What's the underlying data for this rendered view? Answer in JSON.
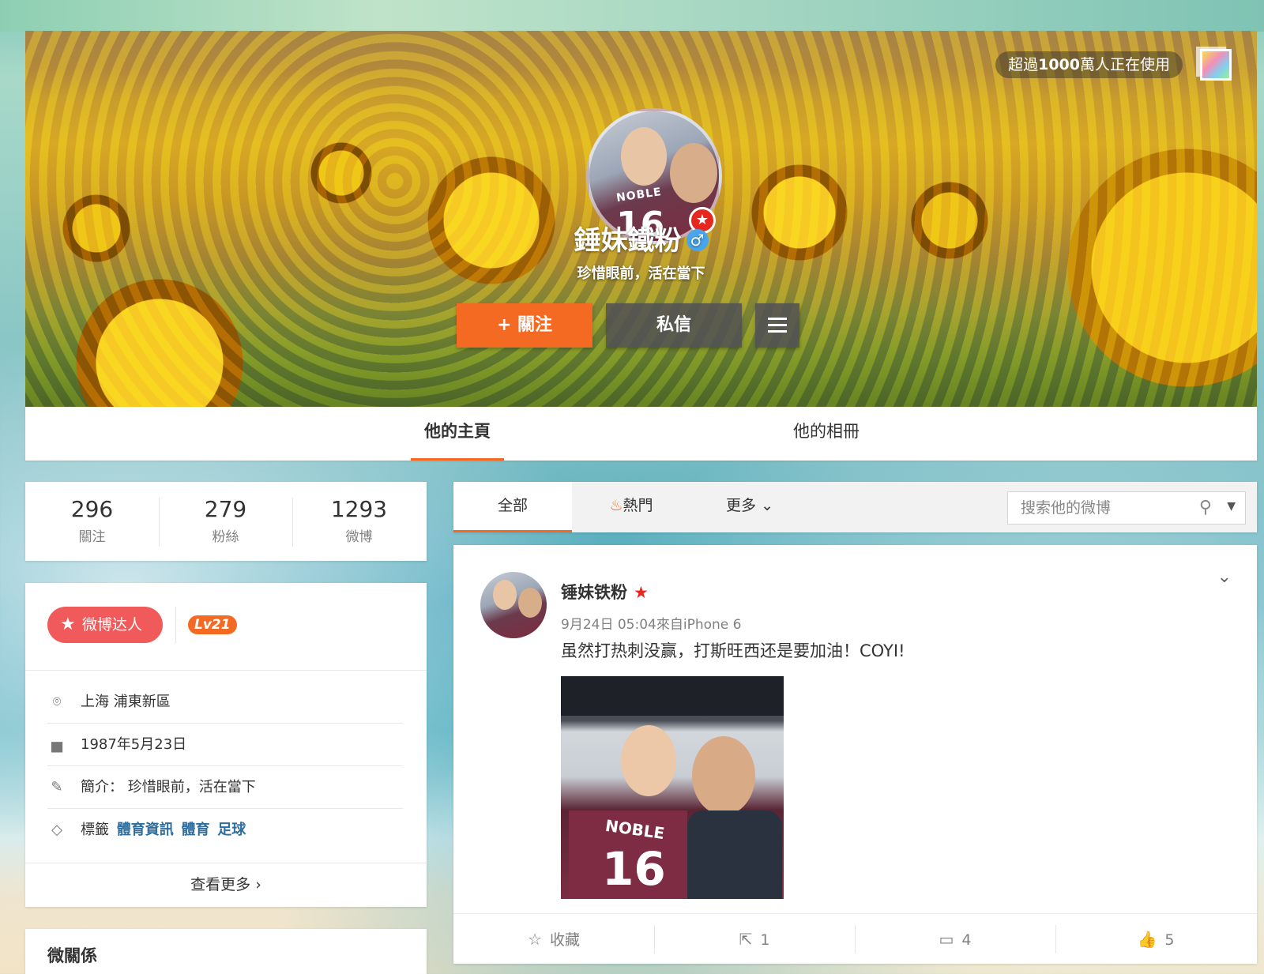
{
  "banner": {
    "usage_prefix": "超過",
    "usage_count": "1000",
    "usage_suffix": "萬人正在使用",
    "nickname": "錘妹鐵粉",
    "gender_symbol": "♂",
    "motto": "珍惜眼前，活在當下",
    "follow_label": "+ 關注",
    "message_label": "私信",
    "avatar_jersey_name": "NOBLE",
    "avatar_jersey_number": "16"
  },
  "tabs": [
    {
      "label": "他的主頁",
      "active": true
    },
    {
      "label": "他的相冊",
      "active": false
    }
  ],
  "stats": [
    {
      "value": "296",
      "label": "關注"
    },
    {
      "value": "279",
      "label": "粉絲"
    },
    {
      "value": "1293",
      "label": "微博"
    }
  ],
  "profile": {
    "talent_badge": "微博达人",
    "level": "Lv21",
    "location": "上海 浦東新區",
    "birthday": "1987年5月23日",
    "intro_label": "簡介：",
    "intro": "珍惜眼前，活在當下",
    "tags_label": "標籤",
    "tags": [
      "體育資訊",
      "體育",
      "足球"
    ],
    "see_more": "查看更多 ›"
  },
  "relation": {
    "title": "微關係"
  },
  "feed_tabs": {
    "all": "全部",
    "hot": "熱門",
    "more": "更多",
    "search_placeholder": "搜索他的微博"
  },
  "post": {
    "author": "锤妹铁粉",
    "date": "9月24日 05:04",
    "source_prefix": "來自",
    "source": "iPhone 6",
    "text": "虽然打热刺没赢，打斯旺西还是要加油！COYI!",
    "photo_jersey_name": "NOBLE",
    "photo_jersey_number": "16",
    "actions": [
      {
        "label": "收藏",
        "icon": "star-outline-icon"
      },
      {
        "label": "1",
        "icon": "share-icon"
      },
      {
        "label": "4",
        "icon": "comment-icon"
      },
      {
        "label": "5",
        "icon": "thumbs-up-icon"
      }
    ]
  },
  "colors": {
    "accent": "#f46a22",
    "talent": "#f05a5a",
    "tag_link": "#2f6e9e",
    "verified_red": "#e6261f",
    "gender_blue": "#4aa6ec"
  }
}
